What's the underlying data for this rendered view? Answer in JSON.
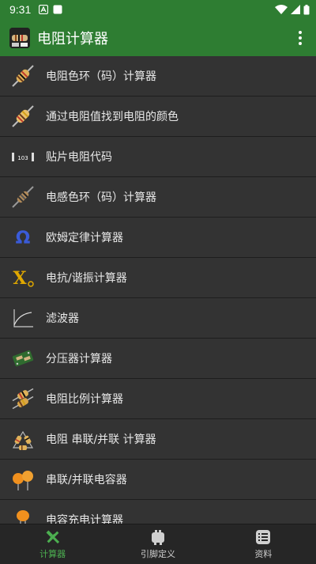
{
  "status_bar": {
    "time": "9:31"
  },
  "app_bar": {
    "title": "电阻计算器",
    "menu_icon": "more-vert-icon"
  },
  "list_items": [
    {
      "label": "电阻色环（码）计算器",
      "icon": "resistor-icon"
    },
    {
      "label": "通过电阻值找到电阻的颜色",
      "icon": "resistor-icon"
    },
    {
      "label": "贴片电阻代码",
      "icon": "smd-resistor-icon",
      "icon_text": "103"
    },
    {
      "label": "电感色环（码）计算器",
      "icon": "inductor-icon"
    },
    {
      "label": "欧姆定律计算器",
      "icon": "ohm-icon",
      "icon_text": "Ω"
    },
    {
      "label": "电抗/谐振计算器",
      "icon": "reactance-icon",
      "icon_text": "X"
    },
    {
      "label": "滤波器",
      "icon": "filter-curve-icon"
    },
    {
      "label": "分压器计算器",
      "icon": "circuit-board-icon"
    },
    {
      "label": "电阻比例计算器",
      "icon": "resistor-pair-icon"
    },
    {
      "label": "电阻 串联/并联 计算器",
      "icon": "resistor-network-icon"
    },
    {
      "label": "串联/并联电容器",
      "icon": "capacitor-pair-icon"
    },
    {
      "label": "电容充电计算器",
      "icon": "capacitor-icon"
    }
  ],
  "bottom_nav": [
    {
      "label": "计算器",
      "icon": "calculator-tools-icon",
      "active": true
    },
    {
      "label": "引脚定义",
      "icon": "connector-icon",
      "active": false
    },
    {
      "label": "资料",
      "icon": "list-icon",
      "active": false
    }
  ],
  "colors": {
    "primary": "#2e7d32",
    "active_tab": "#4caf50",
    "background": "#333333"
  }
}
